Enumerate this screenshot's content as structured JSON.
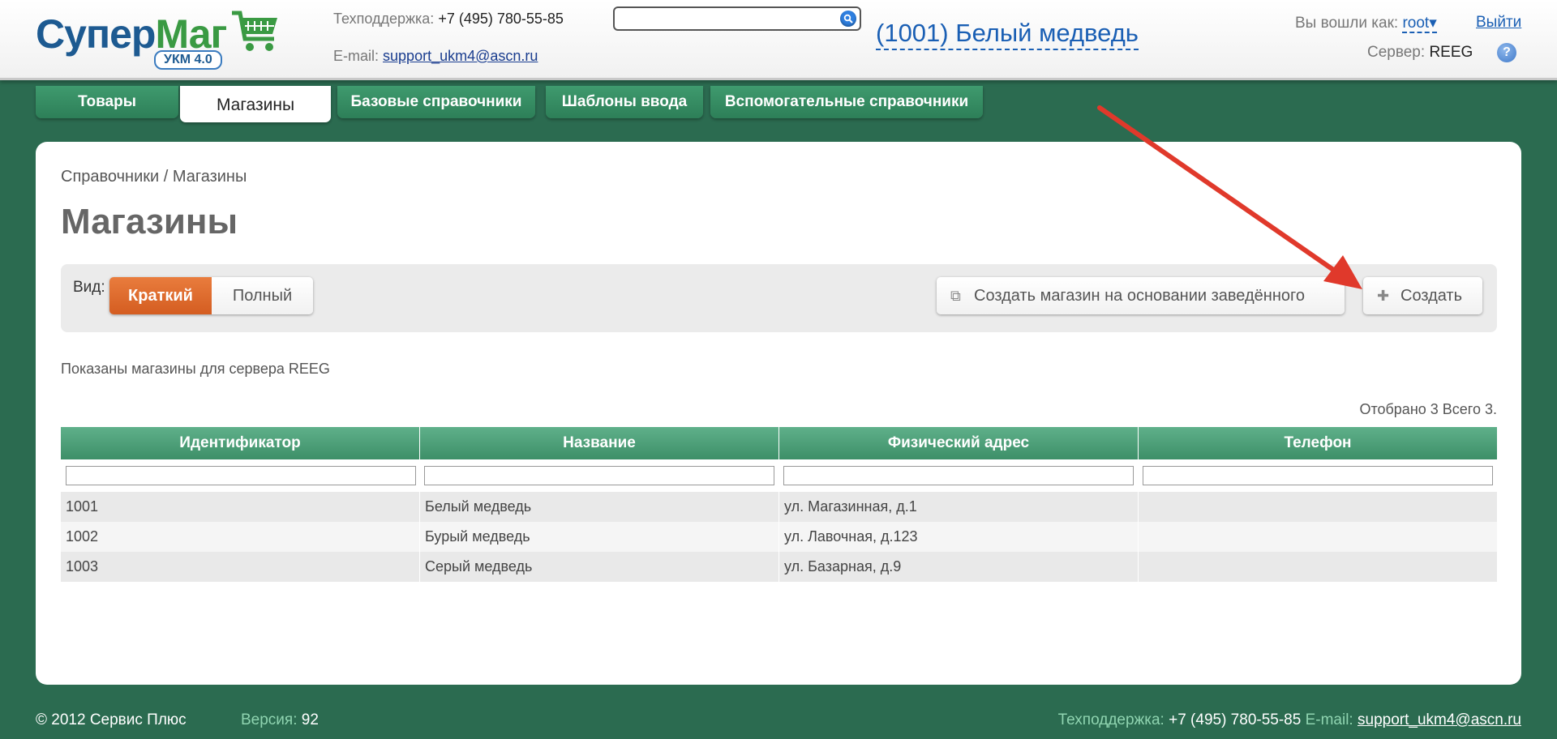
{
  "header": {
    "logo": {
      "brand": "СуперМаг",
      "badge": "УКМ 4.0"
    },
    "support_label": "Техподдержка:",
    "support_phone": "+7 (495) 780-55-85",
    "email_label": "E-mail:",
    "email": "support_ukm4@ascn.ru",
    "search_value": "",
    "store_title": "(1001) Белый медведь",
    "logged_in_label": "Вы вошли как:",
    "user": "root",
    "user_caret": "▾",
    "logout": "Выйти",
    "server_label": "Сервер:",
    "server": "REEG",
    "help": "?"
  },
  "tabs": [
    {
      "label": "Товары",
      "active": false
    },
    {
      "label": "Магазины",
      "active": true
    },
    {
      "label": "Базовые справочники",
      "active": false
    },
    {
      "label": "Шаблоны ввода",
      "active": false
    },
    {
      "label": "Вспомогательные справочники",
      "active": false
    }
  ],
  "main": {
    "breadcrumb": "Справочники  /  Магазины",
    "title": "Магазины",
    "view_label": "Вид:",
    "view_short": "Краткий",
    "view_full": "Полный",
    "create_from_existing": "Создать магазин на основании заведённого",
    "create": "Создать",
    "info": "Показаны магазины для сервера REEG",
    "count": "Отобрано 3 Всего 3."
  },
  "table": {
    "columns": [
      "Идентификатор",
      "Название",
      "Физический адрес",
      "Телефон"
    ],
    "rows": [
      [
        "1001",
        "Белый медведь",
        "ул. Магазинная, д.1",
        ""
      ],
      [
        "1002",
        "Бурый медведь",
        "ул. Лавочная, д.123",
        ""
      ],
      [
        "1003",
        "Серый медведь",
        "ул. Базарная, д.9",
        ""
      ]
    ]
  },
  "footer": {
    "copyright": "© 2012 Сервис Плюс",
    "version_label": "Версия:",
    "version": "92",
    "support_label": "Техподдержка:",
    "support_phone": "+7 (495) 780-55-85",
    "email_label": "E-mail:",
    "email": "support_ukm4@ascn.ru"
  },
  "colors": {
    "background": "#2b6b50",
    "tab": "#3f9a6e",
    "accent_orange": "#e97c3d",
    "link": "#1a5fb4",
    "annotation_arrow": "#e0392b"
  },
  "icons": {
    "search": "search-icon",
    "help": "help-icon",
    "copy": "copy-icon",
    "plus": "plus-icon",
    "cart": "cart-icon"
  }
}
